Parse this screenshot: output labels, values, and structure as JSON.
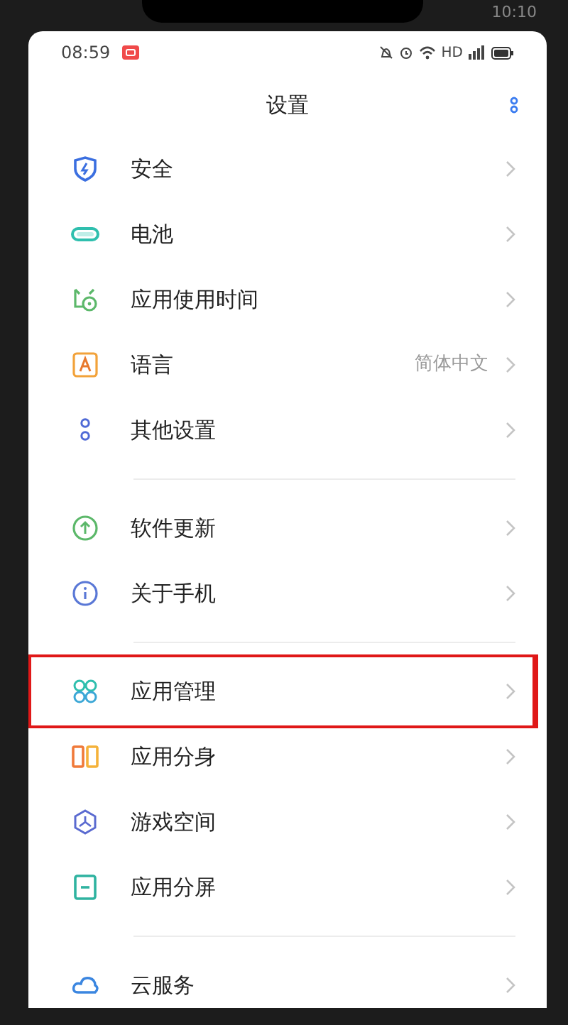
{
  "device_status": {
    "time": "10:10"
  },
  "status_bar": {
    "time": "08:59",
    "network": "HD"
  },
  "header": {
    "title": "设置"
  },
  "groups": [
    {
      "items": [
        {
          "kind": "shield",
          "label": "安全",
          "highlighted": false
        },
        {
          "kind": "battery",
          "label": "电池",
          "highlighted": false
        },
        {
          "kind": "timer",
          "label": "应用使用时间",
          "highlighted": false
        },
        {
          "kind": "letter",
          "label": "语言",
          "value": "简体中文",
          "highlighted": false
        },
        {
          "kind": "dots",
          "label": "其他设置",
          "highlighted": false
        }
      ]
    },
    {
      "items": [
        {
          "kind": "update",
          "label": "软件更新",
          "highlighted": false
        },
        {
          "kind": "info",
          "label": "关于手机",
          "highlighted": false
        }
      ]
    },
    {
      "items": [
        {
          "kind": "apps",
          "label": "应用管理",
          "highlighted": true
        },
        {
          "kind": "clone",
          "label": "应用分身",
          "highlighted": false
        },
        {
          "kind": "game",
          "label": "游戏空间",
          "highlighted": false
        },
        {
          "kind": "split",
          "label": "应用分屏",
          "highlighted": false
        }
      ]
    },
    {
      "items": [
        {
          "kind": "cloud",
          "label": "云服务",
          "highlighted": false
        }
      ]
    }
  ]
}
